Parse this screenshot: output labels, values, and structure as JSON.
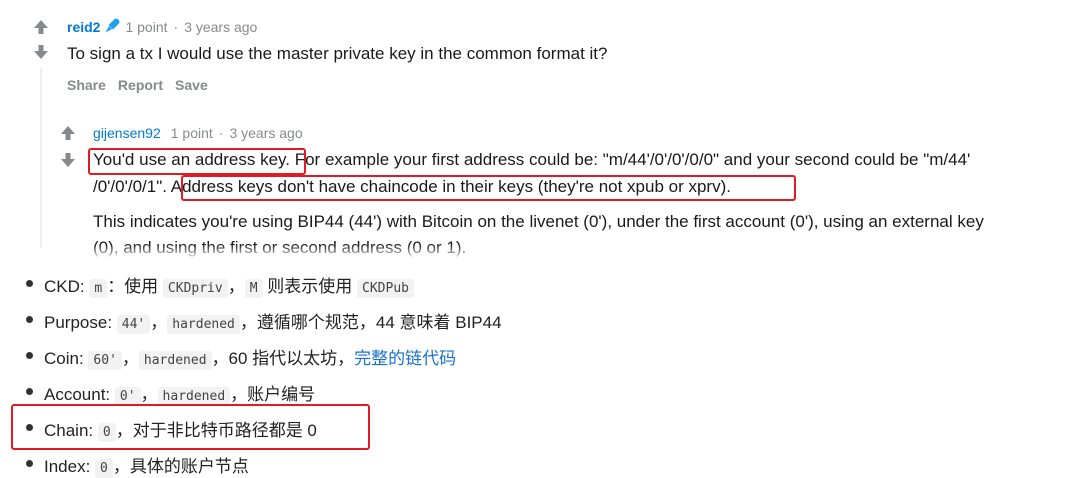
{
  "comment1": {
    "username": "reid2",
    "points": "1 point",
    "separator": "·",
    "age": "3 years ago",
    "body": "To sign a tx I would use the master private key in the common format it?",
    "actions": [
      "Share",
      "Report",
      "Save"
    ]
  },
  "comment2": {
    "username": "gijensen92",
    "points": "1 point",
    "separator": "·",
    "age": "3 years ago",
    "line1_a": "You'd use an address key.",
    "line1_b": " For example your first address could be: \"m/44'/0'/0'/0/0\" and your second could be \"m/44'",
    "line2_a": "/0'/0'/0/1\". ",
    "line2_b": "Address keys don't have chaincode in their keys (they're not xpub or xprv).",
    "line3": "This indicates you're using BIP44 (44') with Bitcoin on the livenet (0'), under the first account (0'), using an external key",
    "line4": "(0), and using the first or second address (0 or 1)."
  },
  "list": {
    "ckd": {
      "label": "CKD:",
      "c1": "m",
      "t1": "：使用",
      "c2": "CKDpriv",
      "t2": "，",
      "c3": "M",
      "t3": " 则表示使用",
      "c4": "CKDPub"
    },
    "purpose": {
      "label": "Purpose:",
      "c1": "44'",
      "t1": "，",
      "c2": "hardened",
      "t2": "，遵循哪个规范，44 意味着 BIP44"
    },
    "coin": {
      "label": "Coin:",
      "c1": "60'",
      "t1": "，",
      "c2": "hardened",
      "t2": "，60 指代以太坊，",
      "link": "完整的链代码"
    },
    "account": {
      "label": "Account:",
      "c1": "0'",
      "t1": "，",
      "c2": "hardened",
      "t2": "，账户编号"
    },
    "chain": {
      "label": "Chain:",
      "c1": "0",
      "t1": "，对于非比特币路径都是 0"
    },
    "index": {
      "label": "Index:",
      "c1": "0",
      "t1": "，具体的账户节点"
    }
  },
  "colors": {
    "highlight_box": "#e01b24",
    "username": "#0079d3",
    "link": "#1a73c8"
  }
}
